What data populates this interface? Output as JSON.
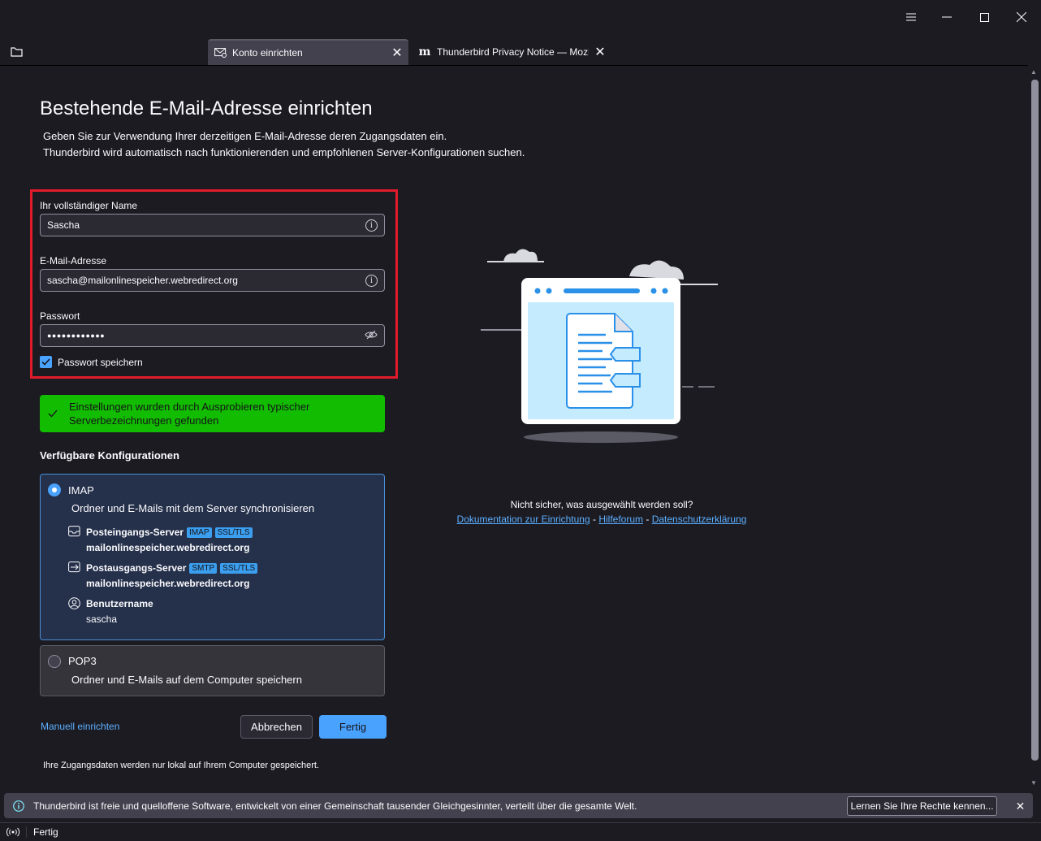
{
  "window": {
    "menu_icon": "hamburger-icon",
    "minimize_icon": "minimize-icon",
    "maximize_icon": "maximize-icon",
    "close_icon": "close-icon"
  },
  "tabs": [
    {
      "label": "Konto einrichten",
      "icon": "mail-settings-icon",
      "active": true
    },
    {
      "label": "Thunderbird Privacy Notice — Mozi",
      "icon": "mozilla-m-icon",
      "active": false
    }
  ],
  "page": {
    "title": "Bestehende E-Mail-Adresse einrichten",
    "subtitle_line1": "Geben Sie zur Verwendung Ihrer derzeitigen E-Mail-Adresse deren Zugangsdaten ein.",
    "subtitle_line2": "Thunderbird wird automatisch nach funktionierenden und empfohlenen Server-Konfigurationen suchen."
  },
  "form": {
    "name_label": "Ihr vollständiger Name",
    "name_value": "Sascha",
    "email_label": "E-Mail-Adresse",
    "email_value": "sascha@mailonlinespeicher.webredirect.org",
    "password_label": "Passwort",
    "password_value": "●●●●●●●●●●●●",
    "remember_label": "Passwort speichern",
    "remember_checked": true,
    "highlight_color": "#e21b2a"
  },
  "success": {
    "text_line1": "Einstellungen wurden durch Ausprobieren typischer",
    "text_line2": "Serverbezeichnungen gefunden",
    "color": "#12bc00"
  },
  "configs": {
    "heading": "Verfügbare Konfigurationen",
    "imap": {
      "title": "IMAP",
      "description": "Ordner und E-Mails mit dem Server synchronisieren",
      "incoming_label": "Posteingangs-Server",
      "incoming_badge1": "IMAP",
      "incoming_badge2": "SSL/TLS",
      "incoming_host": "mailonlinespeicher.webredirect.org",
      "outgoing_label": "Postausgangs-Server",
      "outgoing_badge1": "SMTP",
      "outgoing_badge2": "SSL/TLS",
      "outgoing_host": "mailonlinespeicher.webredirect.org",
      "username_label": "Benutzername",
      "username_value": "sascha"
    },
    "pop3": {
      "title": "POP3",
      "description": "Ordner und E-Mails auf dem Computer speichern"
    }
  },
  "actions": {
    "manual": "Manuell einrichten",
    "cancel": "Abbrechen",
    "done": "Fertig"
  },
  "footer_note": "Ihre Zugangsdaten werden nur lokal auf Ihrem Computer gespeichert.",
  "help": {
    "question": "Nicht sicher, was ausgewählt werden soll?",
    "link1": "Dokumentation zur Einrichtung",
    "sep": "-",
    "link2": "Hilfeforum",
    "link3": "Datenschutzerklärung"
  },
  "notification": {
    "text": "Thunderbird ist freie und quelloffene Software, entwickelt von einer Gemeinschaft tausender Gleichgesinnter, verteilt über die gesamte Welt.",
    "button": "Lernen Sie Ihre Rechte kennen...",
    "close": "✕"
  },
  "statusbar": {
    "text": "Fertig"
  },
  "colors": {
    "background": "#1c1b22",
    "accent": "#4aa2ff",
    "link": "#5db0ff"
  }
}
